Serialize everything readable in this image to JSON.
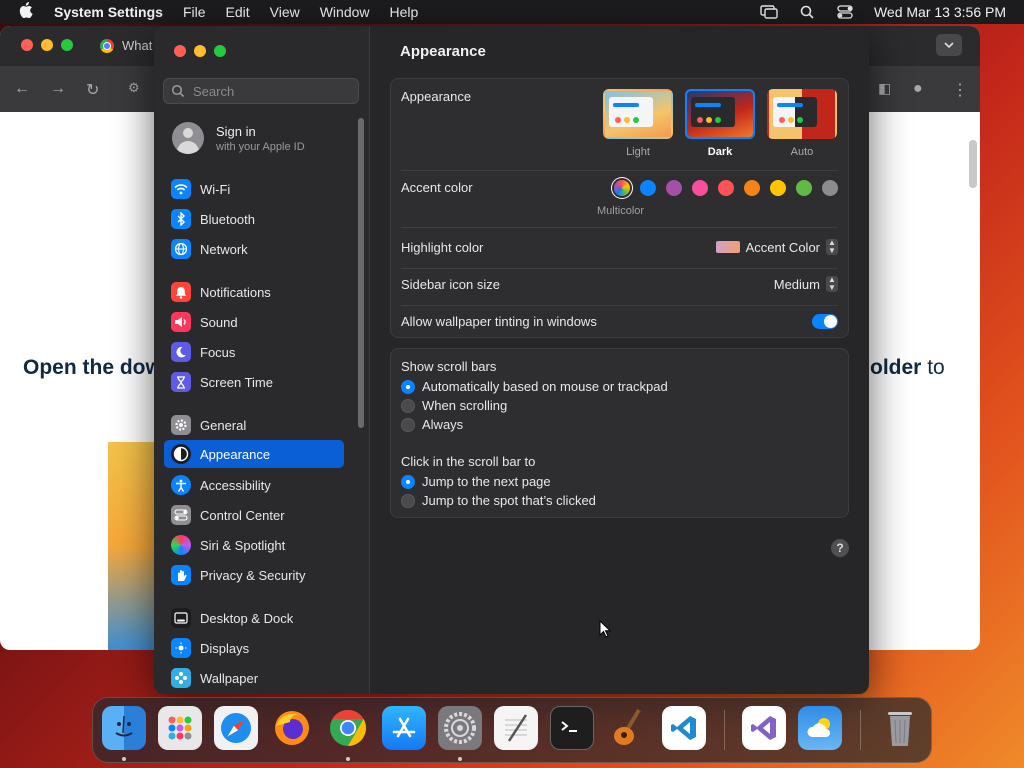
{
  "menubar": {
    "app_name": "System Settings",
    "menus": [
      "File",
      "Edit",
      "View",
      "Window",
      "Help"
    ],
    "datetime": "Wed Mar 13  3:56 PM"
  },
  "browser": {
    "tab_title": "What",
    "page_text_left": "Open the dow",
    "page_text_right_1": "older",
    "page_text_right_2": "to"
  },
  "sidebar": {
    "search_placeholder": "Search",
    "signin_title": "Sign in",
    "signin_subtitle": "with your Apple ID",
    "items": [
      {
        "label": "Wi-Fi",
        "icon": "wifi-icon",
        "color": "#0a84ff"
      },
      {
        "label": "Bluetooth",
        "icon": "bluetooth-icon",
        "color": "#0a84ff"
      },
      {
        "label": "Network",
        "icon": "network-icon",
        "color": "#0a84ff"
      },
      {
        "label": "Notifications",
        "icon": "notifications-icon",
        "color": "#ff453a"
      },
      {
        "label": "Sound",
        "icon": "sound-icon",
        "color": "#ff375f"
      },
      {
        "label": "Focus",
        "icon": "focus-icon",
        "color": "#5e5ce6"
      },
      {
        "label": "Screen Time",
        "icon": "screen-time-icon",
        "color": "#5e5ce6"
      },
      {
        "label": "General",
        "icon": "gear-icon",
        "color": "#8e8e93"
      },
      {
        "label": "Appearance",
        "icon": "appearance-icon",
        "color": "#1c1c1e"
      },
      {
        "label": "Accessibility",
        "icon": "accessibility-icon",
        "color": "#0a84ff"
      },
      {
        "label": "Control Center",
        "icon": "control-center-icon",
        "color": "#8e8e93"
      },
      {
        "label": "Siri & Spotlight",
        "icon": "siri-icon",
        "color": "#bf5af2"
      },
      {
        "label": "Privacy & Security",
        "icon": "hand-icon",
        "color": "#0a84ff"
      },
      {
        "label": "Desktop & Dock",
        "icon": "dock-icon",
        "color": "#1c1c1e"
      },
      {
        "label": "Displays",
        "icon": "displays-icon",
        "color": "#0a84ff"
      },
      {
        "label": "Wallpaper",
        "icon": "wallpaper-icon",
        "color": "#32ade6"
      }
    ],
    "selected": "Appearance"
  },
  "content": {
    "title": "Appearance",
    "appearance_label": "Appearance",
    "appearance_options": [
      "Light",
      "Dark",
      "Auto"
    ],
    "appearance_selected": "Dark",
    "accent_label": "Accent color",
    "accent_colors": [
      "multicolor",
      "#0a84ff",
      "#a550a7",
      "#f74f9e",
      "#ff5257",
      "#f7821b",
      "#ffc600",
      "#62ba46",
      "#8c8c8c"
    ],
    "accent_selected_label": "Multicolor",
    "highlight_label": "Highlight color",
    "highlight_value": "Accent Color",
    "sidebar_icon_label": "Sidebar icon size",
    "sidebar_icon_value": "Medium",
    "wallpaper_tint_label": "Allow wallpaper tinting in windows",
    "wallpaper_tint_on": true,
    "scroll_label": "Show scroll bars",
    "scroll_options": [
      "Automatically based on mouse or trackpad",
      "When scrolling",
      "Always"
    ],
    "scroll_selected": 0,
    "click_label": "Click in the scroll bar to",
    "click_options": [
      "Jump to the next page",
      "Jump to the spot that’s clicked"
    ],
    "click_selected": 0,
    "help": "?"
  },
  "dock": {
    "apps": [
      "Finder",
      "Launchpad",
      "Safari",
      "Firefox",
      "Chrome",
      "App Store",
      "System Settings",
      "TextEdit",
      "Terminal",
      "GarageBand",
      "Visual Studio Code",
      "Visual Studio",
      "Weather",
      "Trash"
    ],
    "running": [
      "Finder",
      "Chrome",
      "System Settings"
    ]
  }
}
